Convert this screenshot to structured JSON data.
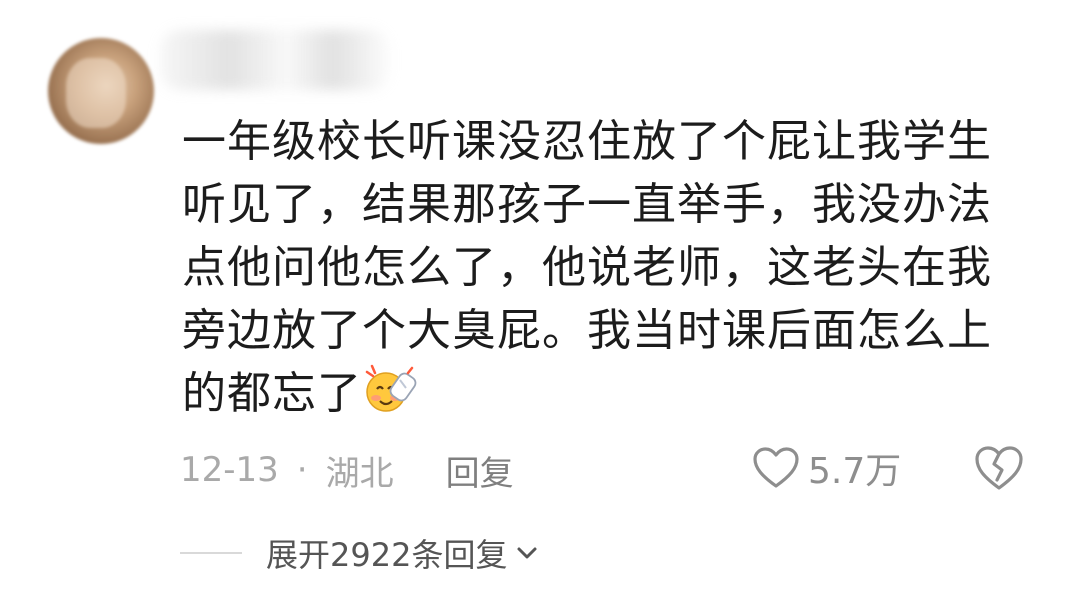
{
  "comment": {
    "text": "一年级校长听课没忍住放了个屁让我学生听见了，结果那孩子一直举手，我没办法点他问他怎么了，他说老师，这老头在我旁边放了个大臭屁。我当时课后面怎么上的都忘了",
    "emoji_icon": "embarrassed-laughing-emoji",
    "date": "12-13",
    "separator": "·",
    "location": "湖北",
    "reply_label": "回复",
    "like_count": "5.7万",
    "expand_label": "展开2922条回复"
  },
  "colors": {
    "text": "#1c1c1c",
    "meta": "#a9a9a9",
    "reply": "#7f7f7f",
    "icon": "#8e8e8e",
    "expand": "#555555"
  }
}
